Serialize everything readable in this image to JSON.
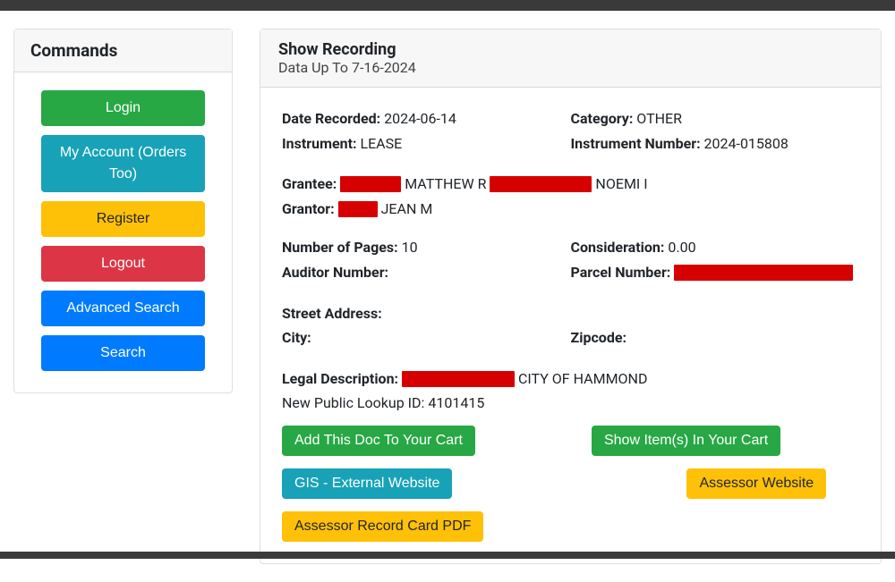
{
  "sidebar": {
    "title": "Commands",
    "buttons": {
      "login": "Login",
      "account": "My Account (Orders Too)",
      "register": "Register",
      "logout": "Logout",
      "adv_search": "Advanced Search",
      "search": "Search"
    }
  },
  "header": {
    "title": "Show Recording",
    "subtitle": "Data Up To 7-16-2024"
  },
  "labels": {
    "date_recorded": "Date Recorded:",
    "category": "Category:",
    "instrument": "Instrument:",
    "instrument_number": "Instrument Number:",
    "grantee": "Grantee:",
    "grantor": "Grantor:",
    "num_pages": "Number of Pages:",
    "consideration": "Consideration:",
    "auditor_number": "Auditor Number:",
    "parcel_number": "Parcel Number:",
    "street_address": "Street Address:",
    "city": "City:",
    "zipcode": "Zipcode:",
    "legal_description": "Legal Description:",
    "lookup_id": "New Public Lookup ID:"
  },
  "record": {
    "date_recorded": "2024-06-14",
    "category": "OTHER",
    "instrument": "LEASE",
    "instrument_number": "2024-015808",
    "grantee_part1": "MATTHEW R",
    "grantee_part2": "NOEMI I",
    "grantor_part1": "JEAN M",
    "num_pages": "10",
    "consideration": "0.00",
    "auditor_number": "",
    "street_address": "",
    "city": "",
    "zipcode": "",
    "legal_desc_tail": "CITY OF HAMMOND",
    "lookup_id": "4101415"
  },
  "actions": {
    "add_cart": "Add This Doc To Your Cart",
    "show_cart": "Show Item(s) In Your Cart",
    "gis": "GIS - External Website",
    "assessor_site": "Assessor Website",
    "assessor_pdf": "Assessor Record Card PDF"
  }
}
